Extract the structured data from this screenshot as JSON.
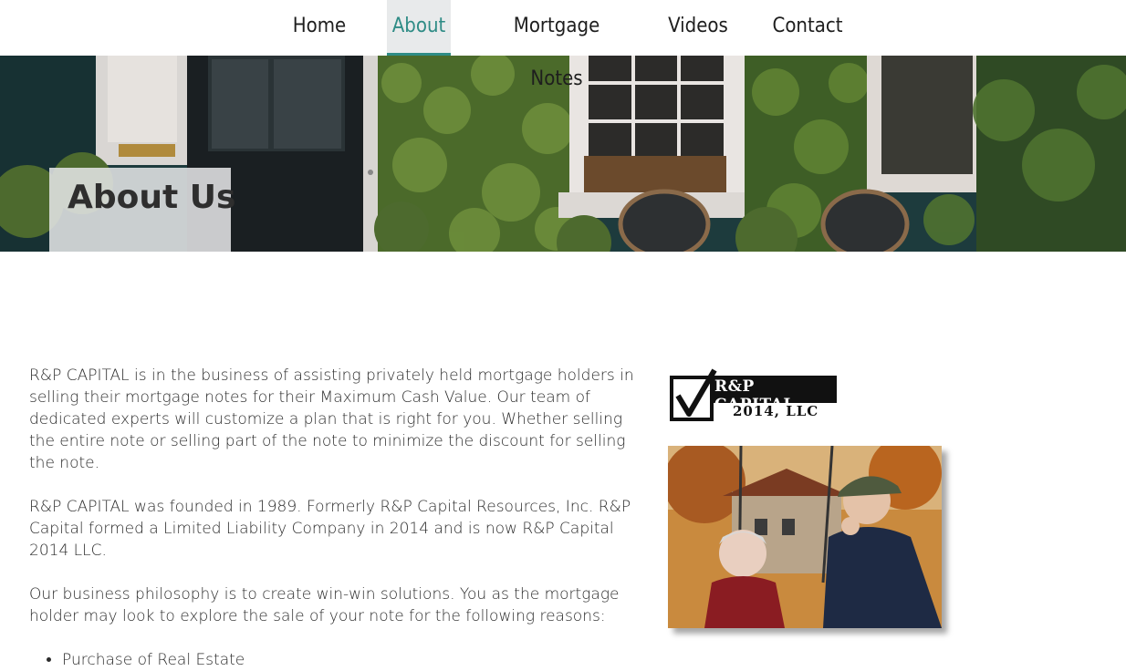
{
  "nav": {
    "items": [
      {
        "label": "Home",
        "active": false
      },
      {
        "label": "About",
        "active": true
      },
      {
        "label": "Mortgage Notes",
        "active": false
      },
      {
        "label": "Videos",
        "active": false
      },
      {
        "label": "Contact",
        "active": false
      }
    ],
    "active_color": "#2f8c86"
  },
  "hero": {
    "title": "About Us"
  },
  "content": {
    "paragraphs": [
      "R&P CAPITAL is in the business of assisting privately held mortgage holders in selling their mortgage notes for their Maximum Cash Value. Our team of dedicated experts will customize a plan that is right for you. Whether selling the entire note or selling part of the note to minimize the discount for selling the note.",
      "R&P CAPITAL was founded in 1989. Formerly R&P Capital Resources, Inc. R&P Capital formed a Limited Liability Company in 2014 and is now R&P Capital 2014 LLC.",
      "Our business philosophy is to create win-win solutions. You as the mortgage holder may look to explore the sale of your note for the following reasons:"
    ],
    "reasons": [
      "Purchase of Real Estate"
    ]
  },
  "logo": {
    "line1": "R&P CAPITAL",
    "line2": "2014, LLC",
    "icon": "checkbox-check-icon"
  },
  "photo": {
    "icon": "elderly-couple-swing-photo"
  }
}
